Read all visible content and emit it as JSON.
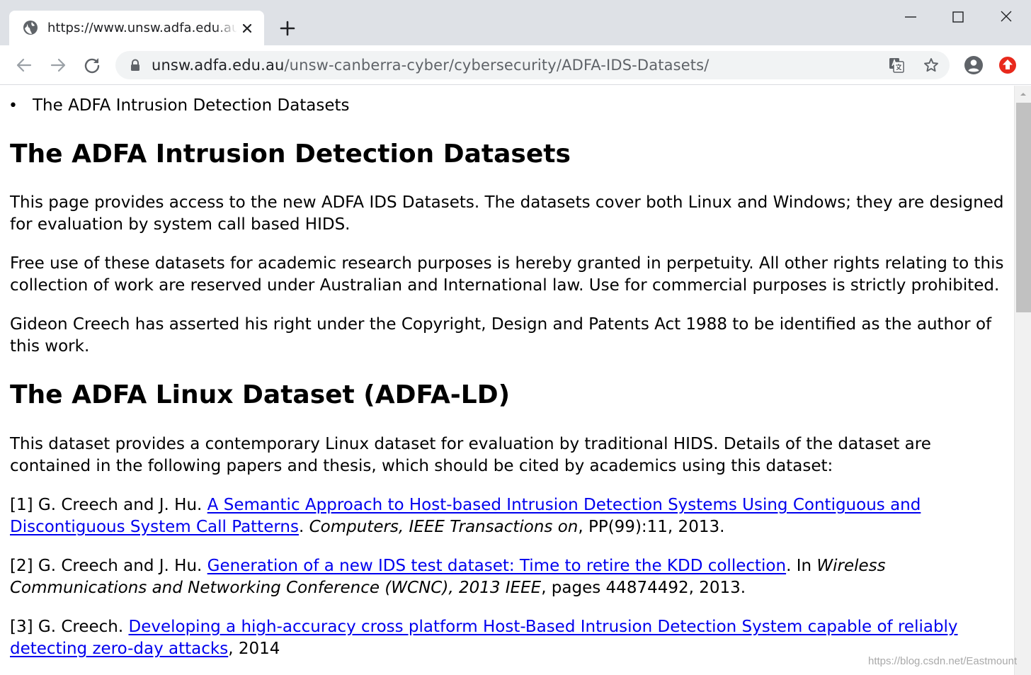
{
  "browser": {
    "tab": {
      "title": "https://www.unsw.adfa.edu.au/unsw-canberra-cyber/cybersecurity/ADFA-IDS-Datasets/",
      "favicon": "globe-icon"
    },
    "address_bar": {
      "url_host": "unsw.adfa.edu.au",
      "url_path": "/unsw-canberra-cyber/cybersecurity/ADFA-IDS-Datasets/"
    },
    "icons": {
      "back": "arrow-left-icon",
      "forward": "arrow-right-icon",
      "reload": "reload-icon",
      "lock": "lock-icon",
      "translate": "translate-icon",
      "bookmark": "star-icon",
      "profile": "account-circle-icon",
      "extension": "upload-arrow-icon"
    },
    "colors": {
      "tabstrip": "#dee1e6",
      "omnibox": "#f1f3f4",
      "link": "#0000ee",
      "extension_badge": "#e8291c"
    }
  },
  "page": {
    "nav_item": "The ADFA Intrusion Detection Datasets",
    "title": "The ADFA Intrusion Detection Datasets",
    "intro": "This page provides access to the new ADFA IDS Datasets. The datasets cover both Linux and Windows; they are designed for evaluation by system call based HIDS.",
    "license": "Free use of these datasets for academic research purposes is hereby granted in perpetuity. All other rights relating to this collection of work are reserved under Australian and International law. Use for commercial purposes is strictly prohibited.",
    "copyright": "Gideon Creech has asserted his right under the Copyright, Design and Patents Act 1988 to be identified as the author of this work.",
    "linux_heading": "The ADFA Linux Dataset (ADFA-LD)",
    "linux_intro": "This dataset provides a contemporary Linux dataset for evaluation by traditional HIDS. Details of the dataset are contained in the following papers and thesis, which should be cited by academics using this dataset:",
    "refs": [
      {
        "prefix": "[1] G. Creech and J. Hu. ",
        "link": "A Semantic Approach to Host-based Intrusion Detection Systems Using Contiguous and Discontiguous System Call Patterns",
        "mid": ". ",
        "venue": "Computers, IEEE Transactions on",
        "suffix": ", PP(99):11, 2013."
      },
      {
        "prefix": "[2] G. Creech and J. Hu. ",
        "link": "Generation of a new IDS test dataset: Time to retire the KDD collection",
        "mid": ". In ",
        "venue": "Wireless Communications and Networking Conference (WCNC), 2013 IEEE",
        "suffix": ", pages 44874492, 2013."
      },
      {
        "prefix": "[3] G. Creech. ",
        "link": "Developing a high-accuracy cross platform Host-Based Intrusion Detection System capable of reliably detecting zero-day attacks",
        "suffix": ", 2014"
      }
    ]
  },
  "watermark": "https://blog.csdn.net/Eastmount"
}
